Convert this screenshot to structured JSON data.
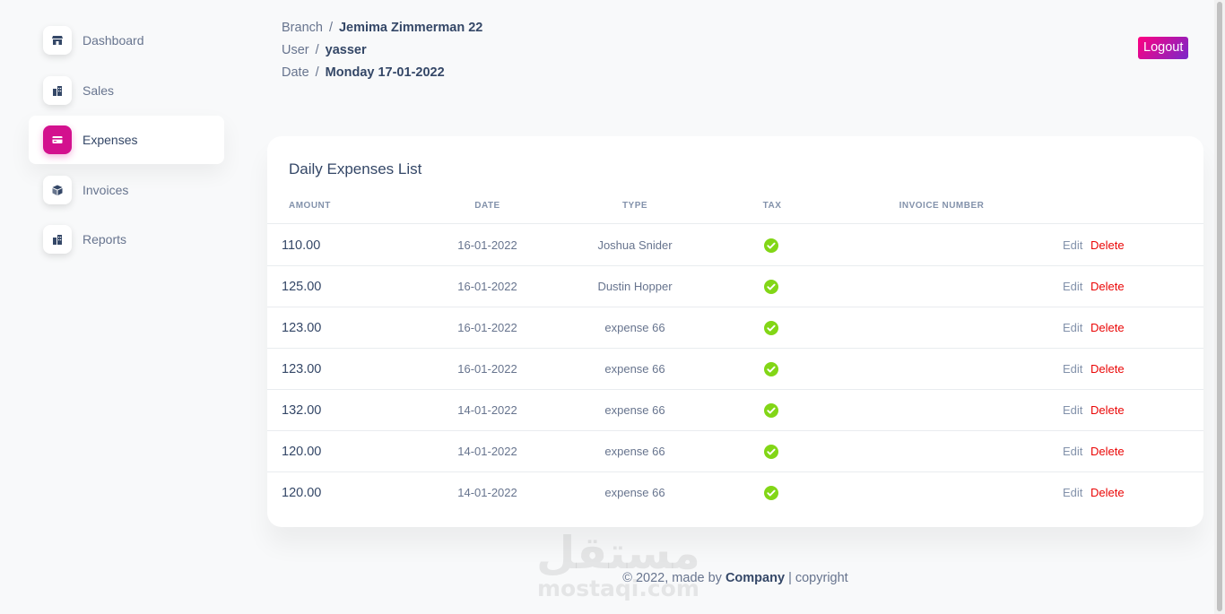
{
  "sidebar": {
    "items": [
      {
        "label": "Dashboard",
        "icon": "shop-icon",
        "active": false
      },
      {
        "label": "Sales",
        "icon": "office-icon",
        "active": false
      },
      {
        "label": "Expenses",
        "icon": "credit-card-icon",
        "active": true
      },
      {
        "label": "Invoices",
        "icon": "box-icon",
        "active": false
      },
      {
        "label": "Reports",
        "icon": "office-icon",
        "active": false
      }
    ],
    "accent_color": "#d3118e"
  },
  "header": {
    "branch_label": "Branch",
    "branch_value": "Jemima Zimmerman 22",
    "user_label": "User",
    "user_value": "yasser",
    "date_label": "Date",
    "date_value": "Monday 17-01-2022",
    "separator": "/",
    "logout_label": "Logout"
  },
  "table": {
    "title": "Daily Expenses List",
    "columns": [
      "Amount",
      "Date",
      "Type",
      "Tax",
      "Invoice Number"
    ],
    "edit_label": "Edit",
    "delete_label": "Delete",
    "tax_icon": "check-circle-icon",
    "tax_color": "#82d616",
    "rows": [
      {
        "amount": "110.00",
        "date": "16-01-2022",
        "type": "Joshua Snider",
        "tax": true,
        "invoice": ""
      },
      {
        "amount": "125.00",
        "date": "16-01-2022",
        "type": "Dustin Hopper",
        "tax": true,
        "invoice": ""
      },
      {
        "amount": "123.00",
        "date": "16-01-2022",
        "type": "expense 66",
        "tax": true,
        "invoice": ""
      },
      {
        "amount": "123.00",
        "date": "16-01-2022",
        "type": "expense 66",
        "tax": true,
        "invoice": ""
      },
      {
        "amount": "132.00",
        "date": "14-01-2022",
        "type": "expense 66",
        "tax": true,
        "invoice": ""
      },
      {
        "amount": "120.00",
        "date": "14-01-2022",
        "type": "expense 66",
        "tax": true,
        "invoice": ""
      },
      {
        "amount": "120.00",
        "date": "14-01-2022",
        "type": "expense 66",
        "tax": true,
        "invoice": ""
      }
    ]
  },
  "footer": {
    "prefix": "© 2022, made by",
    "company": "Company",
    "suffix": "| copyright"
  },
  "watermark": {
    "arabic": "مستقل",
    "latin": "mostaqi.com"
  }
}
